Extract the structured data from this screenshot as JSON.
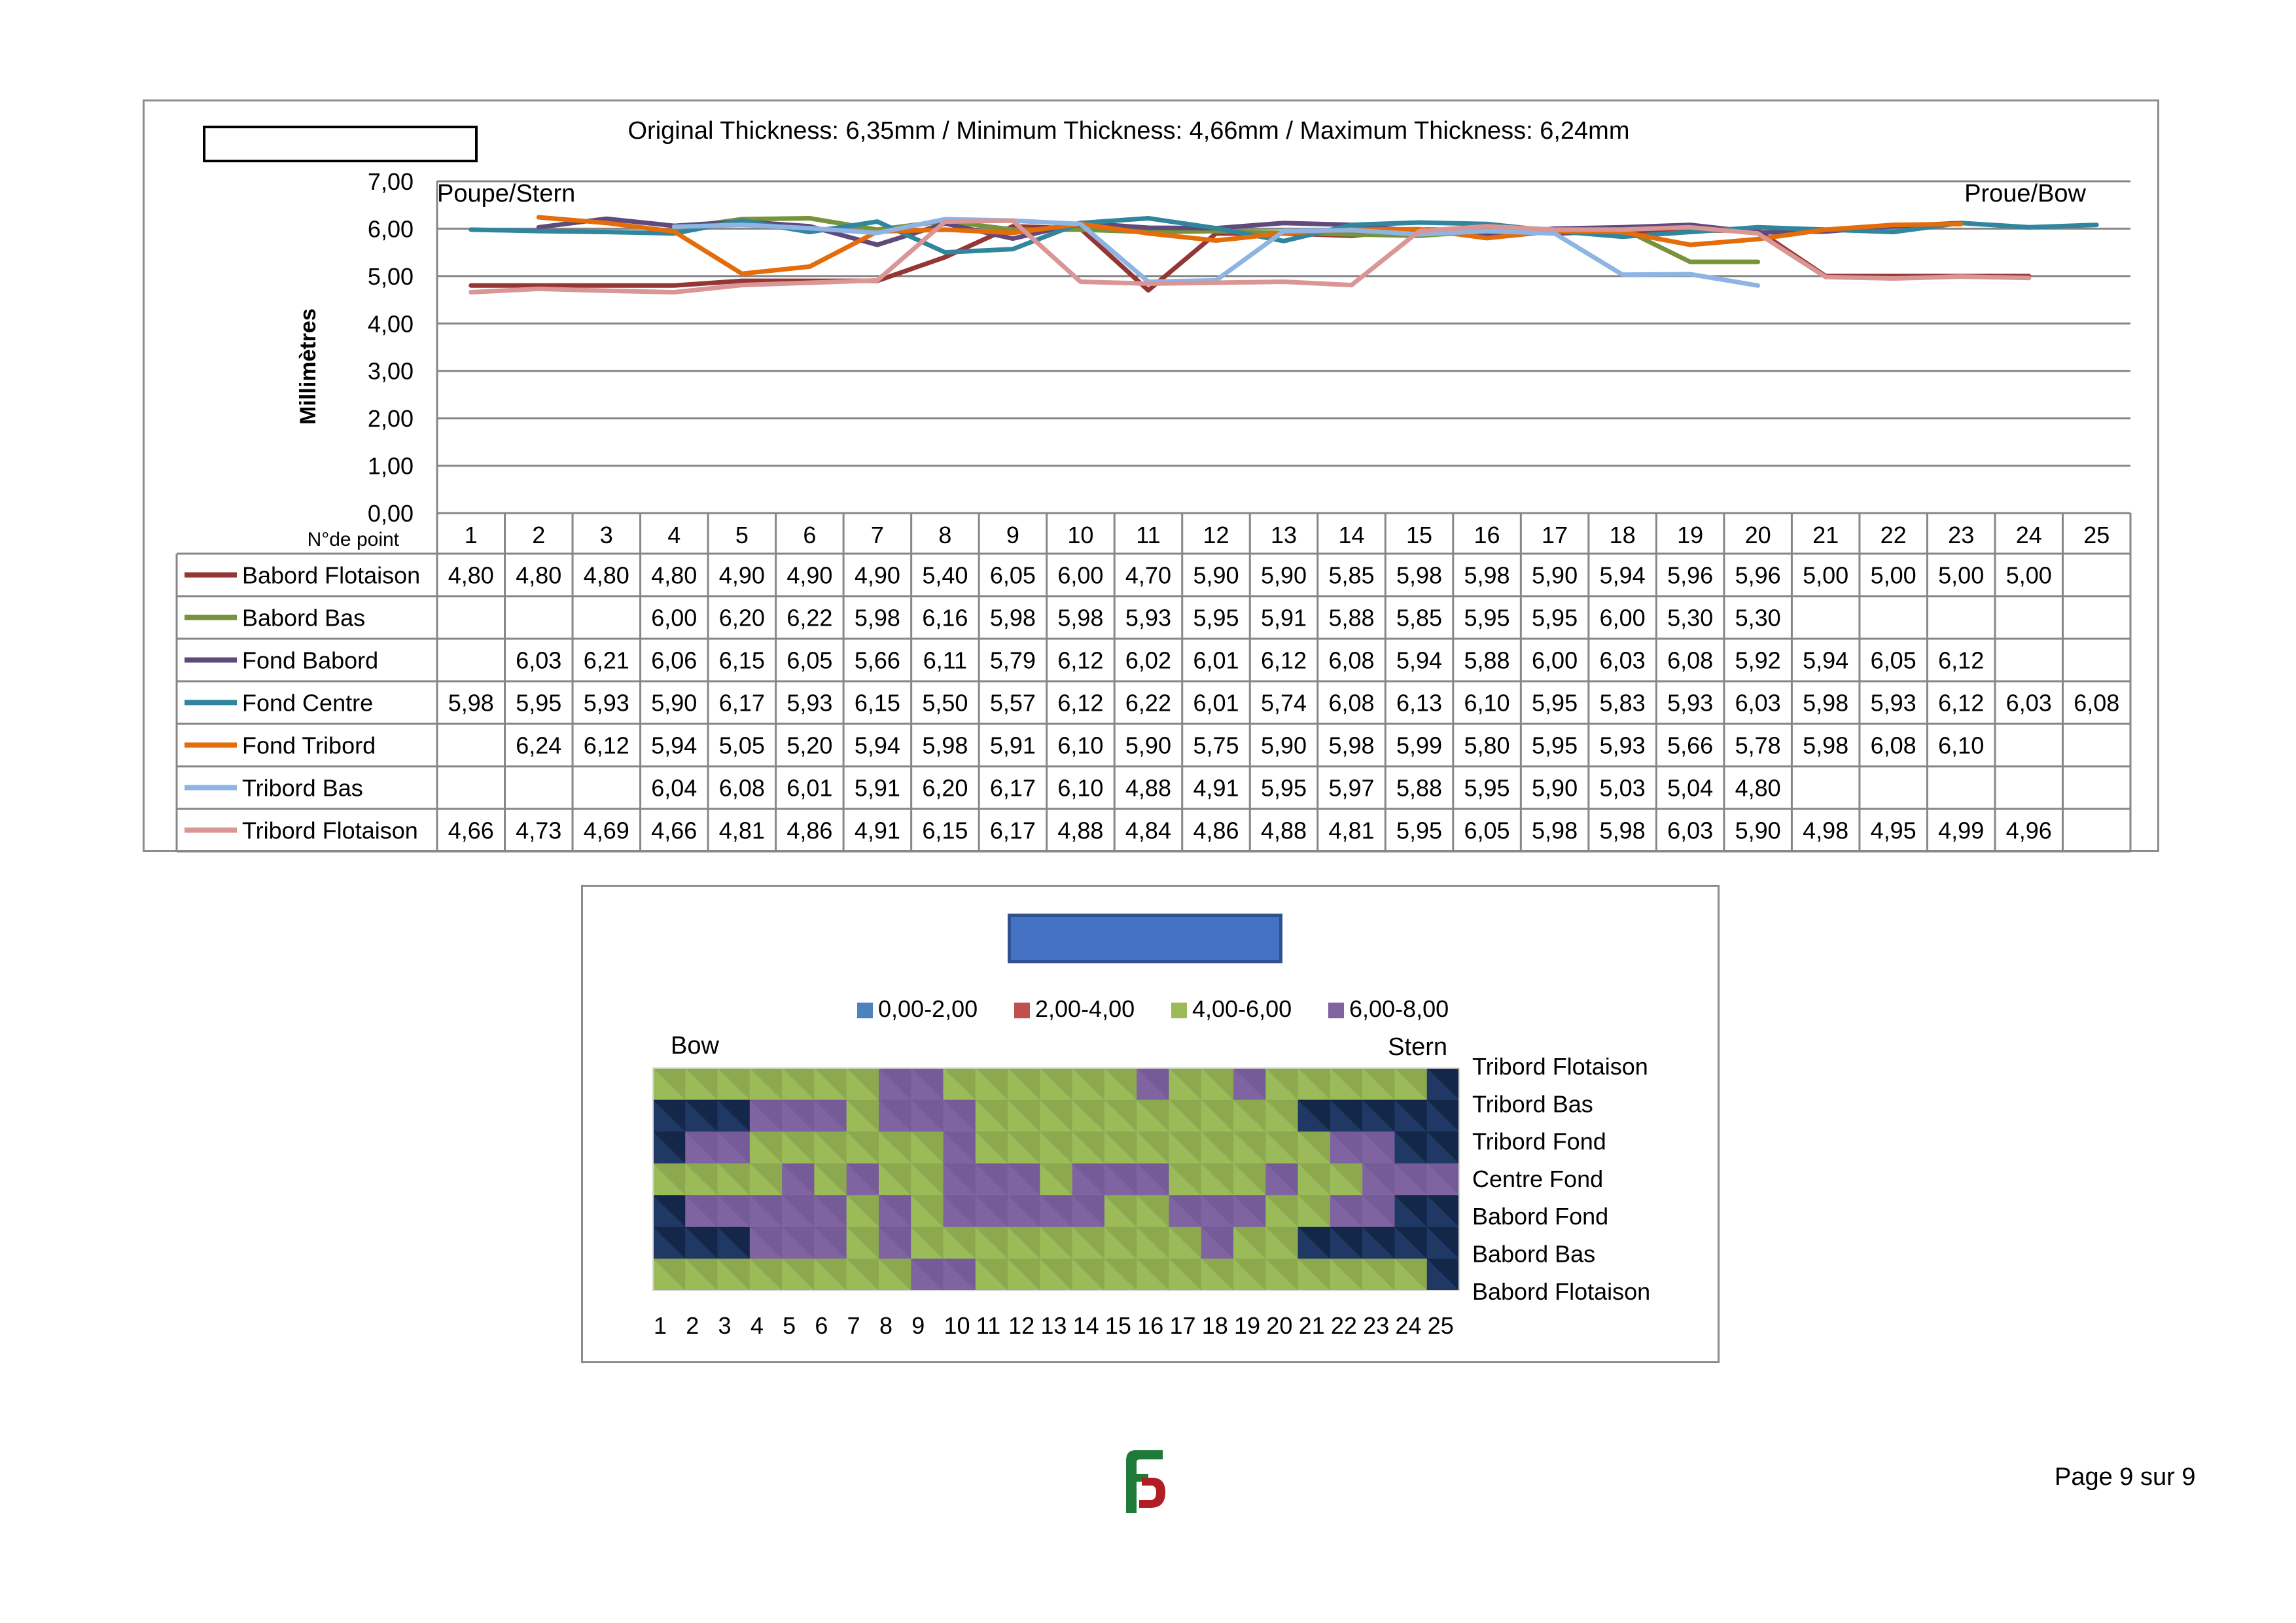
{
  "page": {
    "page_number": "Page 9 sur 9"
  },
  "chart_data": [
    {
      "type": "line",
      "title": "Original Thickness: 6,35mm / Minimum Thickness: 4,66mm / Maximum Thickness: 6,24mm",
      "ylabel": "Millimètres",
      "xlabel": "N°de point",
      "ylim": [
        0,
        7
      ],
      "yticks": [
        "0,00",
        "1,00",
        "2,00",
        "3,00",
        "4,00",
        "5,00",
        "6,00",
        "7,00"
      ],
      "grid": true,
      "left_annotation": "Poupe/Stern",
      "right_annotation": "Proue/Bow",
      "categories": [
        "1",
        "2",
        "3",
        "4",
        "5",
        "6",
        "7",
        "8",
        "9",
        "10",
        "11",
        "12",
        "13",
        "14",
        "15",
        "16",
        "17",
        "18",
        "19",
        "20",
        "21",
        "22",
        "23",
        "24",
        "25"
      ],
      "series": [
        {
          "name": "Babord Flotaison",
          "color": "#943634",
          "values": [
            4.8,
            4.8,
            4.8,
            4.8,
            4.9,
            4.9,
            4.9,
            5.4,
            6.05,
            6.0,
            4.7,
            5.9,
            5.9,
            5.85,
            5.98,
            5.98,
            5.9,
            5.94,
            5.96,
            5.96,
            5.0,
            5.0,
            5.0,
            5.0,
            null
          ],
          "labels": [
            "4,80",
            "4,80",
            "4,80",
            "4,80",
            "4,90",
            "4,90",
            "4,90",
            "5,40",
            "6,05",
            "6,00",
            "4,70",
            "5,90",
            "5,90",
            "5,85",
            "5,98",
            "5,98",
            "5,90",
            "5,94",
            "5,96",
            "5,96",
            "5,00",
            "5,00",
            "5,00",
            "5,00",
            ""
          ]
        },
        {
          "name": "Babord Bas",
          "color": "#77933c",
          "values": [
            null,
            null,
            null,
            6.0,
            6.2,
            6.22,
            5.98,
            6.16,
            5.98,
            5.98,
            5.93,
            5.95,
            5.91,
            5.88,
            5.85,
            5.95,
            5.95,
            6.0,
            5.3,
            5.3,
            null,
            null,
            null,
            null,
            null
          ],
          "labels": [
            "",
            "",
            "",
            "6,00",
            "6,20",
            "6,22",
            "5,98",
            "6,16",
            "5,98",
            "5,98",
            "5,93",
            "5,95",
            "5,91",
            "5,88",
            "5,85",
            "5,95",
            "5,95",
            "6,00",
            "5,30",
            "5,30",
            "",
            "",
            "",
            "",
            ""
          ]
        },
        {
          "name": "Fond Babord",
          "color": "#604a7b",
          "values": [
            null,
            6.03,
            6.21,
            6.06,
            6.15,
            6.05,
            5.66,
            6.11,
            5.79,
            6.12,
            6.02,
            6.01,
            6.12,
            6.08,
            5.94,
            5.88,
            6.0,
            6.03,
            6.08,
            5.92,
            5.94,
            6.05,
            6.12,
            null,
            null
          ],
          "labels": [
            "",
            "6,03",
            "6,21",
            "6,06",
            "6,15",
            "6,05",
            "5,66",
            "6,11",
            "5,79",
            "6,12",
            "6,02",
            "6,01",
            "6,12",
            "6,08",
            "5,94",
            "5,88",
            "6,00",
            "6,03",
            "6,08",
            "5,92",
            "5,94",
            "6,05",
            "6,12",
            "",
            ""
          ]
        },
        {
          "name": "Fond Centre",
          "color": "#31859c",
          "values": [
            5.98,
            5.95,
            5.93,
            5.9,
            6.17,
            5.93,
            6.15,
            5.5,
            5.57,
            6.12,
            6.22,
            6.01,
            5.74,
            6.08,
            6.13,
            6.1,
            5.95,
            5.83,
            5.93,
            6.03,
            5.98,
            5.93,
            6.12,
            6.03,
            6.08
          ],
          "labels": [
            "5,98",
            "5,95",
            "5,93",
            "5,90",
            "6,17",
            "5,93",
            "6,15",
            "5,50",
            "5,57",
            "6,12",
            "6,22",
            "6,01",
            "5,74",
            "6,08",
            "6,13",
            "6,10",
            "5,95",
            "5,83",
            "5,93",
            "6,03",
            "5,98",
            "5,93",
            "6,12",
            "6,03",
            "6,08"
          ]
        },
        {
          "name": "Fond Tribord",
          "color": "#e46c0a",
          "values": [
            null,
            6.24,
            6.12,
            5.94,
            5.05,
            5.2,
            5.94,
            5.98,
            5.91,
            6.1,
            5.9,
            5.75,
            5.9,
            5.98,
            5.99,
            5.8,
            5.95,
            5.93,
            5.66,
            5.78,
            5.98,
            6.08,
            6.1,
            null,
            null
          ],
          "labels": [
            "",
            "6,24",
            "6,12",
            "5,94",
            "5,05",
            "5,20",
            "5,94",
            "5,98",
            "5,91",
            "6,10",
            "5,90",
            "5,75",
            "5,90",
            "5,98",
            "5,99",
            "5,80",
            "5,95",
            "5,93",
            "5,66",
            "5,78",
            "5,98",
            "6,08",
            "6,10",
            "",
            ""
          ]
        },
        {
          "name": "Tribord Bas",
          "color": "#8eb4e3",
          "values": [
            null,
            null,
            null,
            6.04,
            6.08,
            6.01,
            5.91,
            6.2,
            6.17,
            6.1,
            4.88,
            4.91,
            5.95,
            5.97,
            5.88,
            5.95,
            5.9,
            5.03,
            5.04,
            4.8,
            null,
            null,
            null,
            null,
            null
          ],
          "labels": [
            "",
            "",
            "",
            "6,04",
            "6,08",
            "6,01",
            "5,91",
            "6,20",
            "6,17",
            "6,10",
            "4,88",
            "4,91",
            "5,95",
            "5,97",
            "5,88",
            "5,95",
            "5,90",
            "5,03",
            "5,04",
            "4,80",
            "",
            "",
            "",
            "",
            ""
          ]
        },
        {
          "name": "Tribord Flotaison",
          "color": "#d99694",
          "values": [
            4.66,
            4.73,
            4.69,
            4.66,
            4.81,
            4.86,
            4.91,
            6.15,
            6.17,
            4.88,
            4.84,
            4.86,
            4.88,
            4.81,
            5.95,
            6.05,
            5.98,
            5.98,
            6.03,
            5.9,
            4.98,
            4.95,
            4.99,
            4.96,
            null
          ],
          "labels": [
            "4,66",
            "4,73",
            "4,69",
            "4,66",
            "4,81",
            "4,86",
            "4,91",
            "6,15",
            "6,17",
            "4,88",
            "4,84",
            "4,86",
            "4,88",
            "4,81",
            "5,95",
            "6,05",
            "5,98",
            "5,98",
            "6,03",
            "5,90",
            "4,98",
            "4,95",
            "4,99",
            "4,96",
            ""
          ]
        }
      ]
    },
    {
      "type": "heatmap",
      "legend": [
        {
          "label": "0,00-2,00",
          "color": "#4f81bd"
        },
        {
          "label": "2,00-4,00",
          "color": "#c0504d"
        },
        {
          "label": "4,00-6,00",
          "color": "#9bbb59"
        },
        {
          "label": "6,00-8,00",
          "color": "#8064a2"
        }
      ],
      "left_annotation": "Bow",
      "right_annotation": "Stern",
      "rows": [
        "Tribord Flotaison",
        "Tribord Bas",
        "Tribord Fond",
        "Centre Fond",
        "Babord Fond",
        "Babord Bas",
        "Babord Flotaison"
      ],
      "columns": [
        "1",
        "2",
        "3",
        "4",
        "5",
        "6",
        "7",
        "8",
        "9",
        "10",
        "11",
        "12",
        "13",
        "14",
        "15",
        "16",
        "17",
        "18",
        "19",
        "20",
        "21",
        "22",
        "23",
        "24",
        "25"
      ]
    }
  ]
}
